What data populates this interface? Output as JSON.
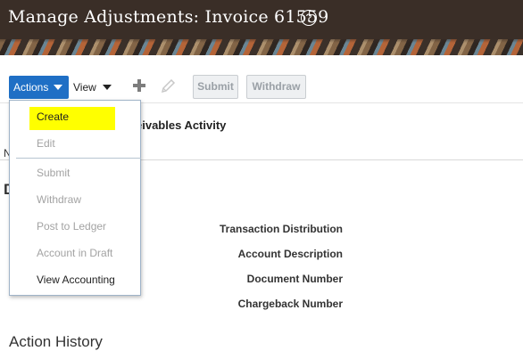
{
  "header": {
    "title": "Manage Adjustments: Invoice 61559",
    "help_glyph": "?"
  },
  "toolbar": {
    "actions_label": "Actions",
    "view_label": "View",
    "submit_label": "Submit",
    "withdraw_label": "Withdraw"
  },
  "actions_menu": {
    "items": [
      {
        "label": "Create",
        "enabled": true,
        "highlighted": true
      },
      {
        "label": "Edit",
        "enabled": false
      },
      {
        "label": "Submit",
        "enabled": false
      },
      {
        "label": "Withdraw",
        "enabled": false
      },
      {
        "label": "Post to Ledger",
        "enabled": false
      },
      {
        "label": "Account in Draft",
        "enabled": false
      },
      {
        "label": "View Accounting",
        "enabled": true
      }
    ],
    "highlight_color": "#ffff00"
  },
  "content": {
    "section_heading_partial": "eivables Activity",
    "stub_left_1": "N",
    "stub_left_2": "D",
    "field_labels": [
      "Transaction Distribution",
      "Account Description",
      "Document Number",
      "Chargeback Number"
    ],
    "bottom_heading_partial": "Action History"
  },
  "colors": {
    "header_bg": "#3a2e27",
    "accent": "#1f6fc5"
  }
}
